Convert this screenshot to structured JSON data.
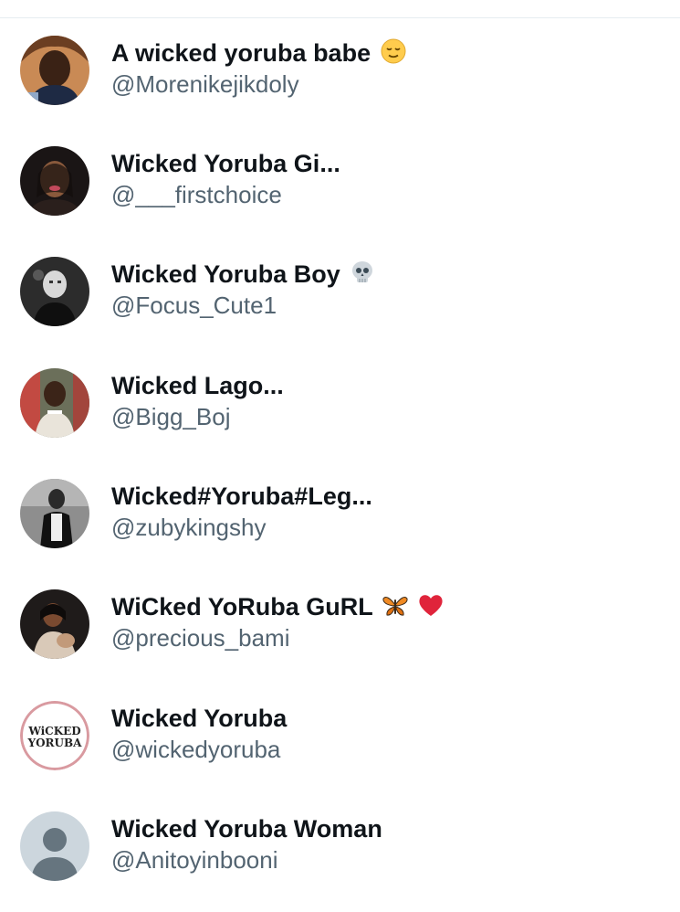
{
  "users": [
    {
      "name": "A wicked yoruba babe",
      "handle": "@Morenikejikdoly",
      "emoji": [
        "relieved-face-emoji"
      ]
    },
    {
      "name": "Wicked Yoruba Gi...",
      "handle": "@___firstchoice",
      "emoji": []
    },
    {
      "name": "Wicked Yoruba Boy",
      "handle": "@Focus_Cute1",
      "emoji": [
        "skull-emoji"
      ]
    },
    {
      "name": "Wicked Lago...",
      "handle": "@Bigg_Boj",
      "emoji": []
    },
    {
      "name": "Wicked#Yoruba#Leg...",
      "handle": "@zubykingshy",
      "emoji": []
    },
    {
      "name": "WiCked YoRuba GuRL",
      "handle": "@precious_bami",
      "emoji": [
        "butterfly-emoji",
        "red-heart-emoji"
      ]
    },
    {
      "name": "Wicked Yoruba",
      "handle": "@wickedyoruba",
      "emoji": [],
      "avatar_logo": [
        "WiCKED",
        "YORUBA"
      ]
    },
    {
      "name": "Wicked Yoruba Woman",
      "handle": "@Anitoyinbooni",
      "emoji": []
    }
  ],
  "colors": {
    "name_text": "#0f1419",
    "handle_text": "#536471",
    "divider": "#e6ecf0",
    "default_avatar_bg": "#ccd6dd",
    "default_avatar_figure": "#66757f"
  }
}
